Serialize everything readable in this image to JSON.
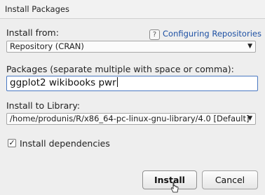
{
  "window": {
    "title": "Install Packages"
  },
  "install_from": {
    "label": "Install from:",
    "value": "Repository (CRAN)",
    "help_link": "Configuring Repositories",
    "help_icon": "question-icon"
  },
  "packages": {
    "label": "Packages (separate multiple with space or comma):",
    "value": "ggplot2 wikibooks pwr"
  },
  "library": {
    "label": "Install to Library:",
    "value": "/home/produnis/R/x86_64-pc-linux-gnu-library/4.0 [Default]"
  },
  "dependencies": {
    "label": "Install dependencies",
    "checked": true
  },
  "buttons": {
    "install": "Install",
    "cancel": "Cancel"
  },
  "colors": {
    "link": "#1c4fa3",
    "focus_border": "#4a78c2"
  }
}
